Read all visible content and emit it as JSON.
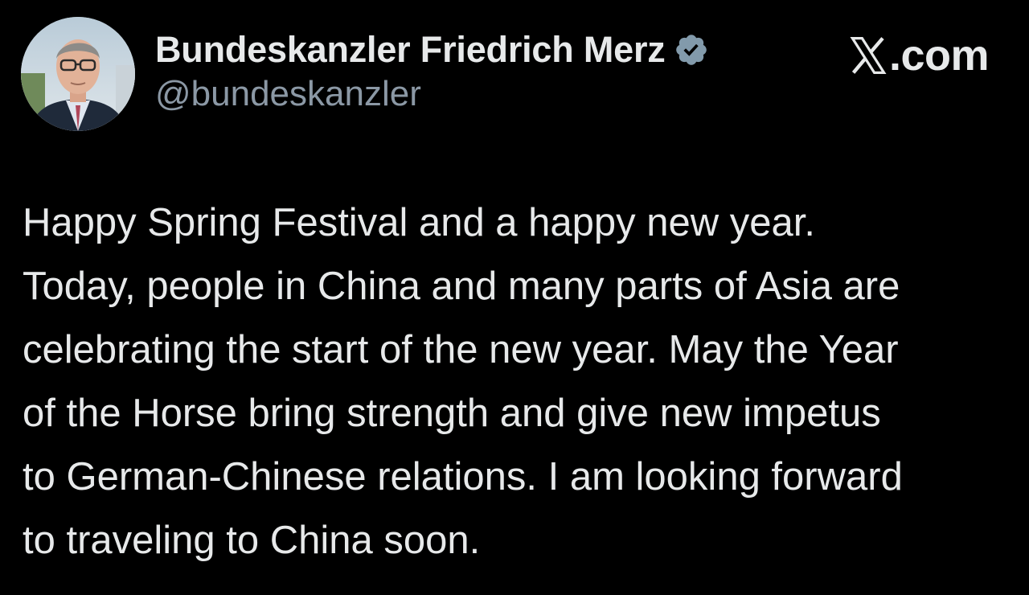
{
  "author": {
    "display_name": "Bundeskanzler Friedrich Merz",
    "handle": "@bundeskanzler",
    "verified_badge_icon": "verified-badge-icon",
    "verified_badge_color": "#829aab"
  },
  "brand": {
    "logo_icon": "x-logo-icon",
    "domain_text": ".com"
  },
  "tweet": {
    "lines": [
      "Happy Spring Festival and a happy new year.",
      "Today, people in China and many parts of Asia are",
      "celebrating the start of the new year. May the Year",
      "of the Horse bring strength and give new impetus",
      "to German-Chinese relations. I am looking forward",
      "to traveling to China soon."
    ]
  },
  "colors": {
    "background": "#000000",
    "primary_text": "#e7e9ea",
    "secondary_text": "#8b98a5"
  }
}
